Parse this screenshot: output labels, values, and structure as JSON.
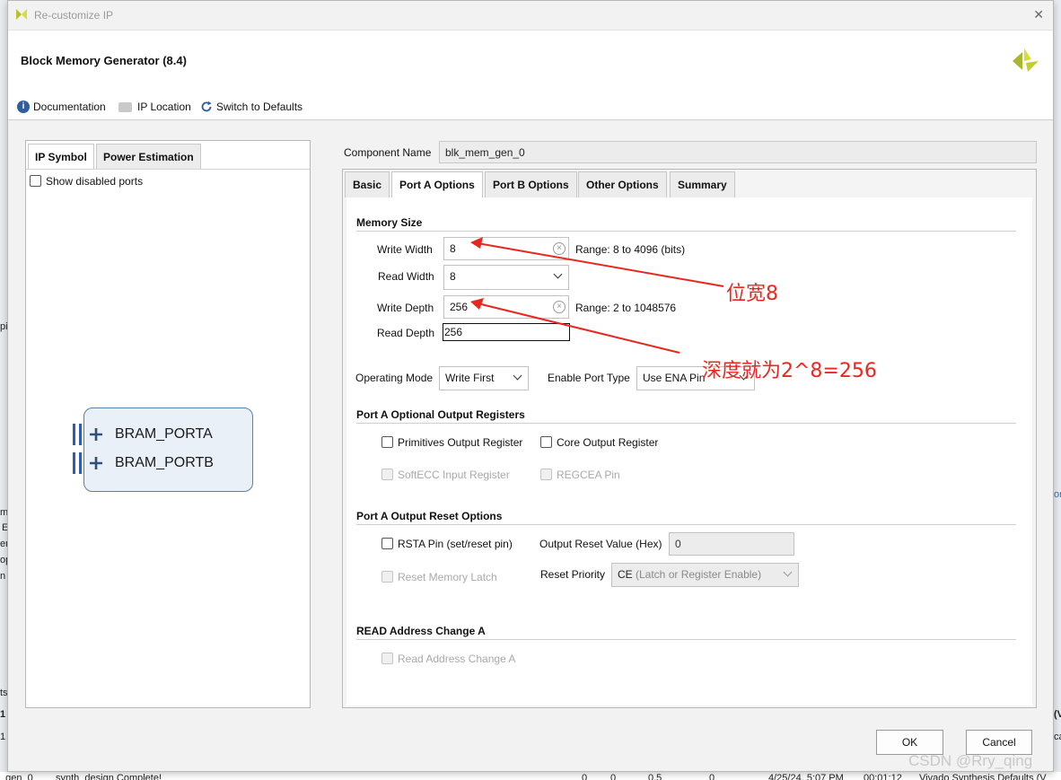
{
  "window": {
    "title": "Re-customize IP",
    "close_glyph": "✕"
  },
  "header": {
    "title": "Block Memory Generator (8.4)",
    "toolbar": [
      {
        "label": "Documentation",
        "icon": "info-icon"
      },
      {
        "label": "IP Location",
        "icon": "folder-icon"
      },
      {
        "label": "Switch to Defaults",
        "icon": "refresh-icon"
      }
    ]
  },
  "left_panel": {
    "tabs": [
      "IP Symbol",
      "Power Estimation"
    ],
    "show_disabled_label": "Show disabled ports",
    "ports": [
      "BRAM_PORTA",
      "BRAM_PORTB"
    ]
  },
  "component": {
    "label": "Component Name",
    "value": "blk_mem_gen_0"
  },
  "tabs": [
    "Basic",
    "Port A Options",
    "Port B Options",
    "Other Options",
    "Summary"
  ],
  "memory_size": {
    "title": "Memory Size",
    "write_width": {
      "label": "Write Width",
      "value": "8",
      "range": "Range: 8 to 4096 (bits)"
    },
    "read_width": {
      "label": "Read Width",
      "value": "8"
    },
    "write_depth": {
      "label": "Write Depth",
      "value": "256",
      "range": "Range: 2 to 1048576"
    },
    "read_depth": {
      "label": "Read Depth",
      "value": "256"
    }
  },
  "operating": {
    "mode_label": "Operating Mode",
    "mode_value": "Write First",
    "enable_label": "Enable Port Type",
    "enable_value": "Use ENA Pin"
  },
  "optional_regs": {
    "title": "Port A Optional Output Registers",
    "primitives": "Primitives Output Register",
    "core": "Core Output Register",
    "softecc": "SoftECC Input Register",
    "regcea": "REGCEA Pin"
  },
  "reset": {
    "title": "Port A Output Reset Options",
    "rsta": "RSTA Pin (set/reset pin)",
    "output_reset_label": "Output Reset Value (Hex)",
    "output_reset_value": "0",
    "reset_latch": "Reset Memory Latch",
    "priority_label": "Reset Priority",
    "priority_prefix": "CE",
    "priority_rest": " (Latch or Register Enable)"
  },
  "read_addr": {
    "title": "READ Address Change A",
    "option": "Read Address Change A"
  },
  "buttons": {
    "ok": "OK",
    "cancel": "Cancel"
  },
  "annotations": {
    "width_note": "位宽8",
    "depth_note": "深度就为2^8=256",
    "arrow_color": "#e8281e"
  },
  "watermark": "CSDN @Rry_qing",
  "background": {
    "left_fragments": [
      "pi",
      "m",
      "E",
      "en",
      "op",
      "n a",
      "ts",
      "1",
      "1"
    ],
    "right_fragments": [
      "or",
      "(V",
      "ca"
    ],
    "bottom_strip": [
      "_gen_0",
      "synth_design Complete!",
      "0",
      "0",
      "0.5",
      "0",
      "4/25/24, 5:07 PM",
      "00:01:12",
      "Vivado Synthesis Defaults (V"
    ]
  }
}
